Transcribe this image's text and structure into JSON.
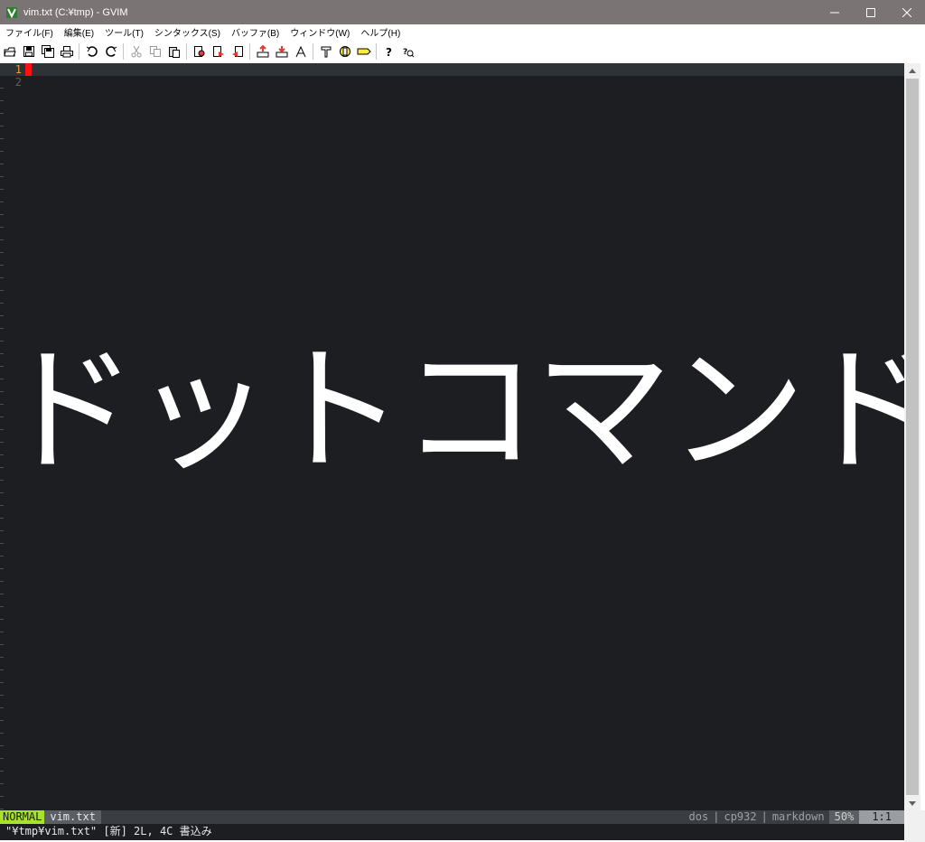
{
  "window": {
    "title": "vim.txt (C:¥tmp) - GVIM",
    "icon": "gvim-icon",
    "controls": {
      "minimize": "—",
      "maximize": "☐",
      "close": "✕"
    }
  },
  "menubar": {
    "items": [
      {
        "label": "ファイル(F)"
      },
      {
        "label": "編集(E)"
      },
      {
        "label": "ツール(T)"
      },
      {
        "label": "シンタックス(S)"
      },
      {
        "label": "バッファ(B)"
      },
      {
        "label": "ウィンドウ(W)"
      },
      {
        "label": "ヘルプ(H)"
      }
    ]
  },
  "toolbar": {
    "groups": [
      [
        "open-icon",
        "save-icon",
        "save-all-icon",
        "print-icon"
      ],
      [
        "undo-icon",
        "redo-icon"
      ],
      [
        "cut-icon",
        "copy-icon",
        "paste-icon"
      ],
      [
        "find-replace-icon",
        "find-next-icon",
        "find-prev-icon"
      ],
      [
        "load-session-icon",
        "save-session-icon",
        "run-script-icon"
      ],
      [
        "make-icon",
        "run-ctags-icon",
        "jump-tag-icon"
      ],
      [
        "help-icon",
        "find-help-icon"
      ]
    ]
  },
  "editor": {
    "lines": [
      {
        "number": "1",
        "text": "",
        "current": true
      },
      {
        "number": "2",
        "text": "",
        "current": false
      }
    ],
    "overlay_text": "ドットコマンド",
    "colors": {
      "background": "#1d1e21",
      "cursor": "#ff1111",
      "current_line_number": "#e0a33b"
    }
  },
  "statusline": {
    "mode": "NORMAL",
    "filename": "vim.txt",
    "fileformat": "dos",
    "encoding": "cp932",
    "filetype": "markdown",
    "separator": "|",
    "percent": "50%",
    "position": "1:1",
    "mode_color": "#a6e22e"
  },
  "cmdline": {
    "message": "\"¥tmp¥vim.txt\" [新] 2L, 4C 書込み"
  }
}
